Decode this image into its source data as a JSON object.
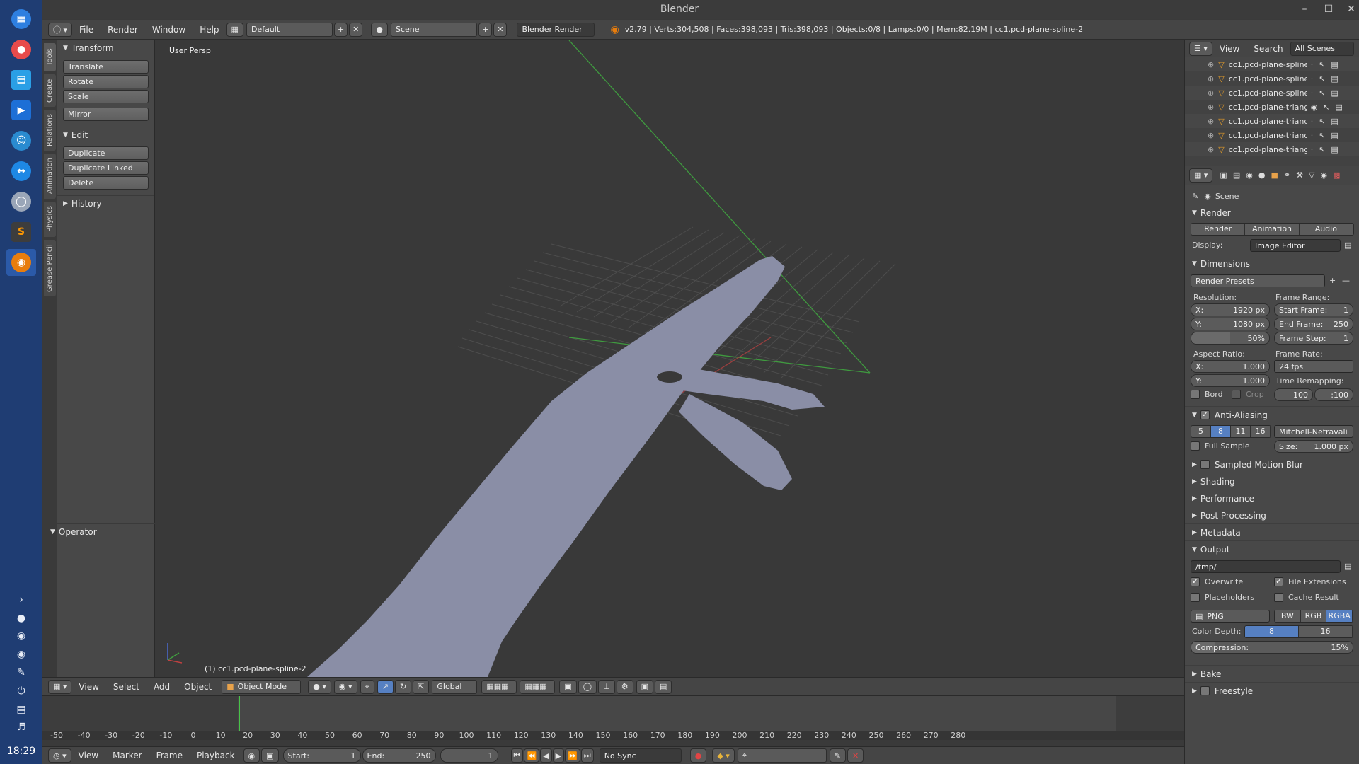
{
  "window": {
    "title": "Blender"
  },
  "dock": {
    "clock": "18:29"
  },
  "header": {
    "menus": [
      "File",
      "Render",
      "Window",
      "Help"
    ],
    "layout": "Default",
    "scene": "Scene",
    "engine": "Blender Render",
    "stats": "v2.79 | Verts:304,508 | Faces:398,093 | Tris:398,093 | Objects:0/8 | Lamps:0/0 | Mem:82.19M | cc1.pcd-plane-spline-2"
  },
  "toolshelf": {
    "tabs": [
      "Tools",
      "Create",
      "Relations",
      "Animation",
      "Physics",
      "Grease Pencil"
    ],
    "transform": {
      "title": "Transform",
      "buttons": [
        "Translate",
        "Rotate",
        "Scale",
        "Mirror"
      ]
    },
    "edit": {
      "title": "Edit",
      "buttons": [
        "Duplicate",
        "Duplicate Linked",
        "Delete"
      ]
    },
    "history": "History",
    "operator": "Operator"
  },
  "viewport": {
    "label": "User Persp",
    "object": "(1) cc1.pcd-plane-spline-2"
  },
  "viewbar": {
    "menus": [
      "View",
      "Select",
      "Add",
      "Object"
    ],
    "mode": "Object Mode",
    "orientation": "Global"
  },
  "timeline": {
    "ticks": [
      "-50",
      "-40",
      "-30",
      "-20",
      "-10",
      "0",
      "10",
      "20",
      "30",
      "40",
      "50",
      "60",
      "70",
      "80",
      "90",
      "100",
      "110",
      "120",
      "130",
      "140",
      "150",
      "160",
      "170",
      "180",
      "190",
      "200",
      "210",
      "220",
      "230",
      "240",
      "250",
      "260",
      "270",
      "280"
    ],
    "menus": [
      "View",
      "Marker",
      "Frame",
      "Playback"
    ],
    "start_label": "Start:",
    "start": "1",
    "end_label": "End:",
    "end": "250",
    "current": "1",
    "sync": "No Sync"
  },
  "outliner": {
    "menus": [
      "View",
      "Search"
    ],
    "filter": "All Scenes",
    "rows": [
      "cc1.pcd-plane-spline-",
      "cc1.pcd-plane-spline-",
      "cc1.pcd-plane-spline-",
      "cc1.pcd-plane-triangl",
      "cc1.pcd-plane-triangl",
      "cc1.pcd-plane-triangl",
      "cc1.pcd-plane-triangl"
    ]
  },
  "properties": {
    "scene": "Scene",
    "render": {
      "title": "Render",
      "buttons": [
        "Render",
        "Animation",
        "Audio"
      ],
      "display_label": "Display:",
      "display": "Image Editor"
    },
    "dimensions": {
      "title": "Dimensions",
      "presets": "Render Presets",
      "resolution_label": "Resolution:",
      "res_x_label": "X:",
      "res_x": "1920 px",
      "res_y_label": "Y:",
      "res_y": "1080 px",
      "res_pct": "50%",
      "frame_range_label": "Frame Range:",
      "start_label": "Start Frame:",
      "start": "1",
      "end_label": "End Frame:",
      "end": "250",
      "step_label": "Frame Step:",
      "step": "1",
      "aspect_label": "Aspect Ratio:",
      "asp_x_label": "X:",
      "asp_x": "1.000",
      "asp_y_label": "Y:",
      "asp_y": "1.000",
      "frame_rate_label": "Frame Rate:",
      "fps": "24 fps",
      "remap_label": "Time Remapping:",
      "remap_old": "100",
      "remap_new": ":100",
      "bord": "Bord",
      "crop": "Crop"
    },
    "aa": {
      "title": "Anti-Aliasing",
      "samples": [
        "5",
        "8",
        "11",
        "16"
      ],
      "filter": "Mitchell-Netravali",
      "full_sample": "Full Sample",
      "size_label": "Size:",
      "size": "1.000 px"
    },
    "sections": [
      "Sampled Motion Blur",
      "Shading",
      "Performance",
      "Post Processing",
      "Metadata"
    ],
    "output": {
      "title": "Output",
      "path": "/tmp/",
      "overwrite": "Overwrite",
      "file_ext": "File Extensions",
      "placeholders": "Placeholders",
      "cache": "Cache Result",
      "format": "PNG",
      "color_modes": [
        "BW",
        "RGB",
        "RGBA"
      ],
      "depth_label": "Color Depth:",
      "depths": [
        "8",
        "16"
      ],
      "compression_label": "Compression:",
      "compression": "15%"
    },
    "bottom_sections": [
      "Bake",
      "Freestyle"
    ]
  },
  "colors": {
    "accent": "#5680c2",
    "mesh": "#8a8ea6",
    "dock": "#1f3d73"
  }
}
